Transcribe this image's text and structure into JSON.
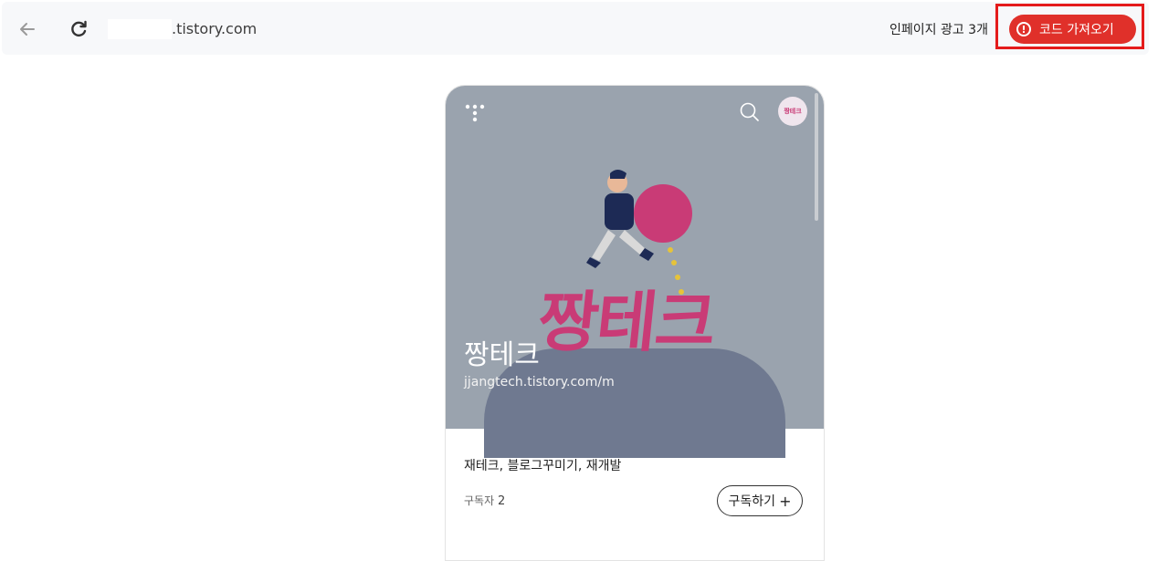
{
  "browser": {
    "url_suffix": ".tistory.com",
    "back_icon": "arrow-left-icon",
    "reload_icon": "reload-icon"
  },
  "toolbar": {
    "ad_label": "인페이지 광고 3개",
    "import_button": "코드 가져오기",
    "import_icon": "warning-circle-icon",
    "accent_color": "#e0302a"
  },
  "blog": {
    "title": "짱테크",
    "url": "jjangtech.tistory.com/m",
    "cover_logo": "짱테크",
    "avatar_text": "짱테크",
    "categories": "재테크, 블로그꾸미기, 재개발",
    "subscribers_label": "구독자",
    "subscribers_count": "2",
    "subscribe_button": "구독하기"
  }
}
